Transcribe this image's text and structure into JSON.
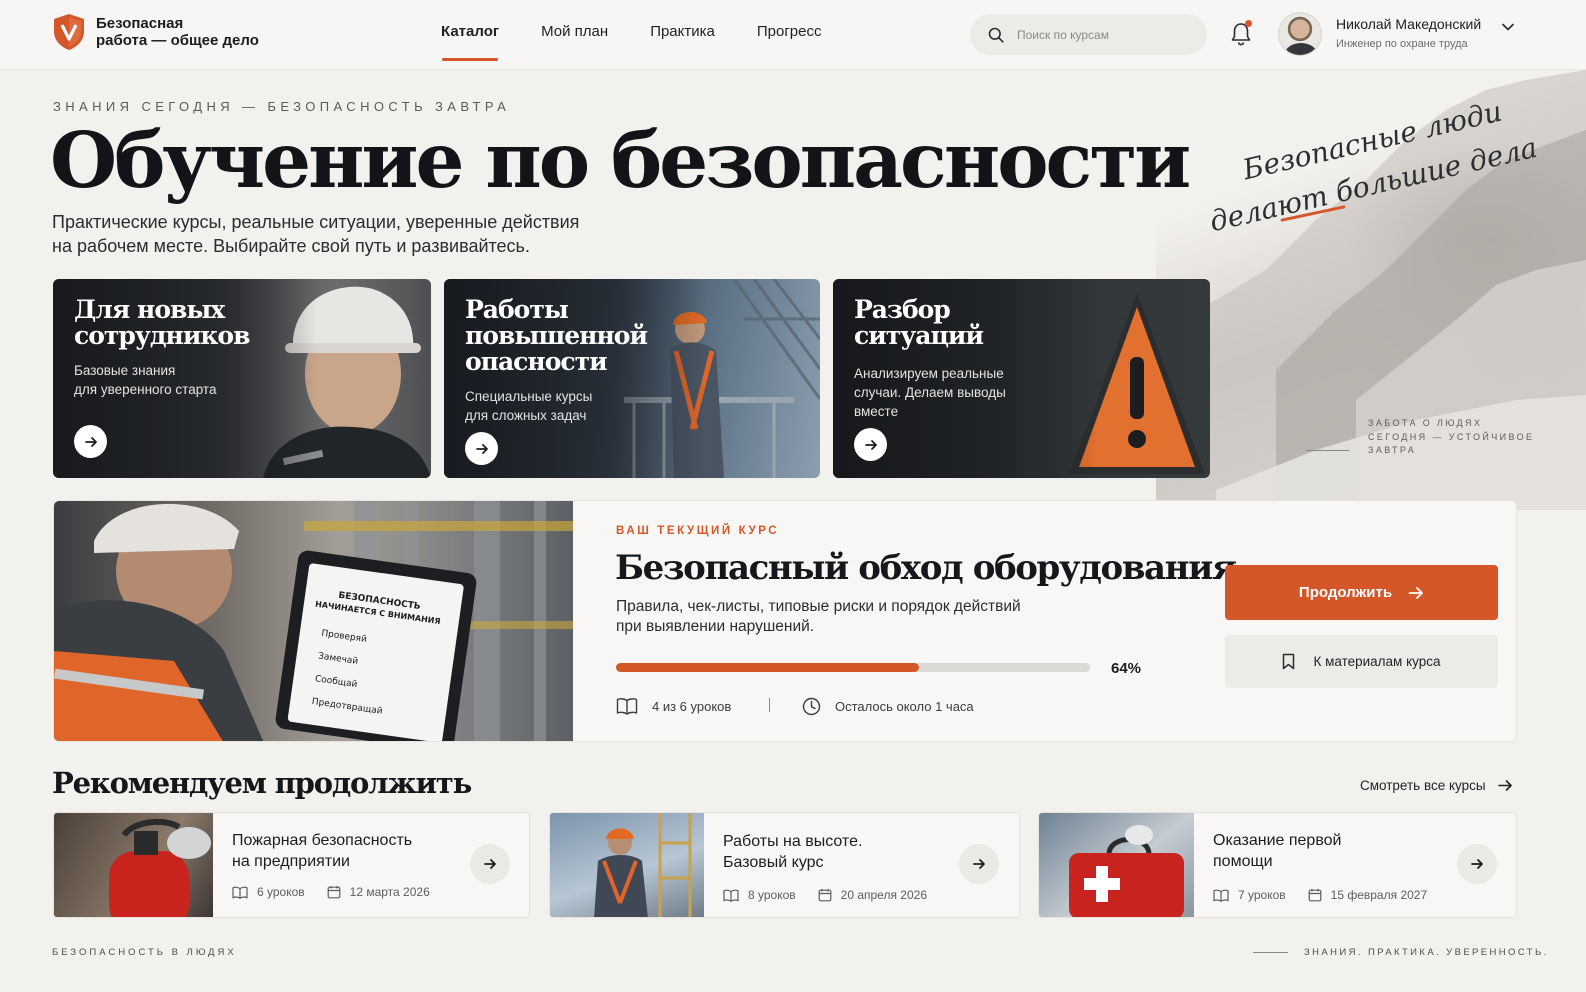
{
  "header": {
    "logo_line1": "Безопасная",
    "logo_line2": "работа — общее дело",
    "nav": [
      {
        "label": "Каталог",
        "active": true
      },
      {
        "label": "Мой план",
        "active": false
      },
      {
        "label": "Практика",
        "active": false
      },
      {
        "label": "Прогресс",
        "active": false
      }
    ],
    "search_placeholder": "Поиск по курсам",
    "notifications_unread": true,
    "user_name": "Николай Македонский",
    "user_role": "Инженер по охране труда"
  },
  "hero": {
    "eyebrow": "ЗНАНИЯ СЕГОДНЯ — БЕЗОПАСНОСТЬ ЗАВТРА",
    "title": "Обучение по безопасности",
    "subtitle_line1": "Практические курсы, реальные ситуации, уверенные действия",
    "subtitle_line2": "на рабочем месте. Выбирайте свой путь и развивайтесь.",
    "script_line1": "Безопасные люди",
    "script_line2": "делают большие дела",
    "side_note": [
      "ЗАБОТА О ЛЮДЯХ",
      "СЕГОДНЯ — УСТОЙЧИВОЕ",
      "ЗАВТРА"
    ]
  },
  "categories": [
    {
      "title_lines": [
        "Для новых",
        "сотрудников"
      ],
      "desc_lines": [
        "Базовые знания",
        "для уверенного старта"
      ]
    },
    {
      "title_lines": [
        "Работы",
        "повышенной",
        "опасности"
      ],
      "desc_lines": [
        "Специальные курсы",
        "для сложных задач"
      ]
    },
    {
      "title_lines": [
        "Разбор",
        "ситуаций"
      ],
      "desc_lines": [
        "Анализируем реальные",
        "случаи. Делаем выводы",
        "вместе"
      ]
    }
  ],
  "current_course": {
    "eyebrow": "ВАШ ТЕКУЩИЙ КУРС",
    "title": "Безопасный обход оборудования",
    "desc_line1": "Правила, чек-листы, типовые риски и порядок действий",
    "desc_line2": "при выявлении нарушений.",
    "progress_value": 64,
    "progress_label": "64%",
    "lessons": "4 из 6 уроков",
    "time_left": "Осталось около 1 часа",
    "continue_label": "Продолжить",
    "materials_label": "К материалам курса",
    "clipboard": {
      "title_line1": "БЕЗОПАСНОСТЬ",
      "title_line2": "НАЧИНАЕТСЯ С ВНИМАНИЯ",
      "items": [
        "Проверяй",
        "Замечай",
        "Сообщай",
        "Предотвращай"
      ]
    }
  },
  "recommended": {
    "title": "Рекомендуем продолжить",
    "see_all": "Смотреть все курсы",
    "items": [
      {
        "name_lines": [
          "Пожарная безопасность",
          "на предприятии"
        ],
        "lessons": "6 уроков",
        "date": "12 марта 2026"
      },
      {
        "name_lines": [
          "Работы на высоте.",
          "Базовый курс"
        ],
        "lessons": "8 уроков",
        "date": "20 апреля 2026"
      },
      {
        "name_lines": [
          "Оказание первой",
          "помощи"
        ],
        "lessons": "7 уроков",
        "date": "15 февраля 2027"
      }
    ]
  },
  "footer": {
    "left": "БЕЗОПАСНОСТЬ В ЛЮДЯХ",
    "right": "ЗНАНИЯ. ПРАКТИКА. УВЕРЕННОСТЬ."
  },
  "colors": {
    "accent": "#d4572a",
    "background": "#f3f1ee",
    "text": "#15171a"
  }
}
